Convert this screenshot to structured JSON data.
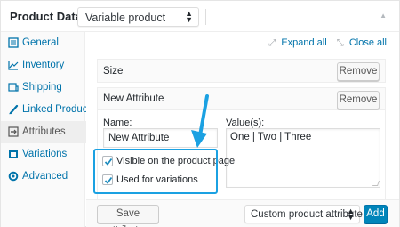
{
  "header": {
    "title": "Product Data —",
    "product_type": "Variable product",
    "toggle_icon": "triangle-up-icon"
  },
  "tabs": [
    {
      "label": "General",
      "icon": "gear-icon"
    },
    {
      "label": "Inventory",
      "icon": "chart-icon"
    },
    {
      "label": "Shipping",
      "icon": "truck-icon"
    },
    {
      "label": "Linked Products",
      "icon": "link-icon"
    },
    {
      "label": "Attributes",
      "icon": "list-icon"
    },
    {
      "label": "Variations",
      "icon": "grid-icon"
    },
    {
      "label": "Advanced",
      "icon": "settings-icon"
    }
  ],
  "active_tab": "Attributes",
  "main": {
    "expand_all": "Expand all",
    "close_all": "Close all",
    "attributes": [
      {
        "name": "Size",
        "remove_label": "Remove"
      },
      {
        "name": "New Attribute",
        "remove_label": "Remove",
        "name_label": "Name:",
        "name_value": "New Attribute",
        "values_label": "Value(s):",
        "values_value": "One | Two | Three",
        "visible_label": "Visible on the product page",
        "visible_checked": true,
        "variations_label": "Used for variations",
        "variations_checked": true
      }
    ]
  },
  "toolbar": {
    "save_label": "Save attributes",
    "attribute_select": "Custom product attribute",
    "add_label": "Add"
  },
  "colors": {
    "accent": "#0073aa",
    "highlight": "#1ba1e2",
    "primary_button": "#0085ba"
  }
}
